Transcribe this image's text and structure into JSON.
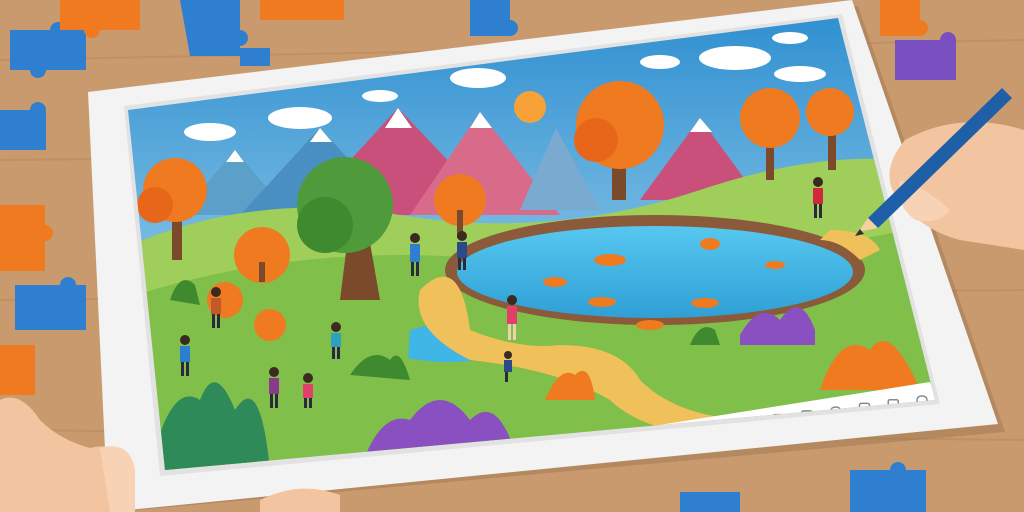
{
  "scene": {
    "description_free": true,
    "colors": {
      "table": "#c99a6e",
      "table_dark": "#b98558",
      "tablet_frame": "#f3f3f3",
      "tablet_shadow": "#9c7550",
      "sky_top": "#2f8fd0",
      "sky_bottom": "#bfe6f5",
      "grass": "#7fbf4a",
      "grass_dark": "#4f9a3a",
      "water": "#3fb6e6",
      "path": "#f0c05a",
      "autumn": "#f07a20",
      "accent_active": "#f05a22",
      "toolbar_icon": "#8a8a8a"
    }
  },
  "toolbar": {
    "icons": [
      "image-icon",
      "search-icon",
      "chat-icon",
      "star-icon",
      "camera-icon",
      "record-icon",
      "grid-icon",
      "layers-icon",
      "frame-icon",
      "puzzle-icon",
      "folder-icon",
      "circle-icon",
      "square-icon",
      "share-icon",
      "brush-icon",
      "text-icon",
      "crop-icon",
      "screen-icon",
      "video-icon",
      "puzzle-piece-icon",
      "photo-icon",
      "info-icon"
    ],
    "active_icon": "record-icon"
  },
  "puzzle_pieces": {
    "colors": [
      "#2f7fd0",
      "#f07a20",
      "#7a4fc0"
    ]
  },
  "pencil": {
    "color": "#1f5fa8"
  }
}
